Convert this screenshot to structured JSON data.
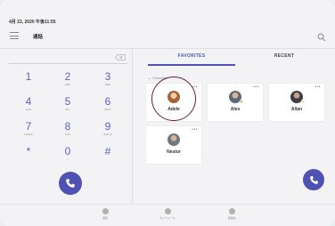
{
  "status": {
    "datetime": "4月 22, 2020  午後11:55"
  },
  "header": {
    "title": "通話",
    "menu_icon": "hamburger-icon",
    "search_icon": "search-icon"
  },
  "dialpad": {
    "keys": [
      {
        "digit": "1",
        "letters": ""
      },
      {
        "digit": "2",
        "letters": "ABC"
      },
      {
        "digit": "3",
        "letters": "DEF"
      },
      {
        "digit": "4",
        "letters": "GHI"
      },
      {
        "digit": "5",
        "letters": "JKL"
      },
      {
        "digit": "6",
        "letters": "MNO"
      },
      {
        "digit": "7",
        "letters": "PQRS"
      },
      {
        "digit": "8",
        "letters": "TUV"
      },
      {
        "digit": "9",
        "letters": "WXYZ"
      },
      {
        "digit": "*",
        "letters": ""
      },
      {
        "digit": "0",
        "letters": "+"
      },
      {
        "digit": "#",
        "letters": ""
      }
    ]
  },
  "tabs": {
    "favorites": "FAVORITES",
    "recent": "RECENT"
  },
  "favorites": {
    "section_label": "Favorites",
    "contacts": [
      {
        "name": "Adele",
        "more": "•••"
      },
      {
        "name": "Alex",
        "more": "•••"
      },
      {
        "name": "Allan",
        "more": "•••"
      },
      {
        "name": "Nestor",
        "more": "•••"
      }
    ]
  },
  "bottom_nav": {
    "items": [
      "通話",
      "ボイスメール",
      "連絡先"
    ]
  },
  "colors": {
    "accent": "#4f52b2",
    "highlight_ring": "#6b1f35",
    "presence": "#6bb700"
  }
}
